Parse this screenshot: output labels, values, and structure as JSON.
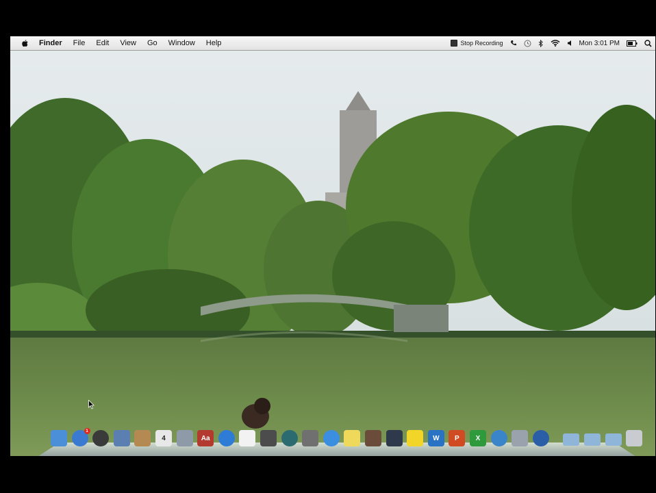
{
  "menubar": {
    "app_name": "Finder",
    "menus": [
      "File",
      "Edit",
      "View",
      "Go",
      "Window",
      "Help"
    ],
    "status": {
      "recording_label": "Stop Recording",
      "clock": "Mon 3:01 PM"
    }
  },
  "icons": {
    "apple": "apple-icon",
    "stop_recording": "stop-recording-icon",
    "phone": "phone-icon",
    "time_machine": "time-machine-icon",
    "bluetooth": "bluetooth-icon",
    "wifi": "wifi-icon",
    "volume": "volume-icon",
    "battery": "battery-icon",
    "spotlight": "spotlight-icon"
  },
  "dock": {
    "items": [
      {
        "name": "finder-icon",
        "color": "#4a8fd8"
      },
      {
        "name": "app-store-icon",
        "color": "#3a7ad0",
        "badge": "1"
      },
      {
        "name": "dashboard-icon",
        "color": "#3a3a3a"
      },
      {
        "name": "preview-icon",
        "color": "#5b7fb0"
      },
      {
        "name": "contacts-icon",
        "color": "#b58a52"
      },
      {
        "name": "calendar-icon",
        "color": "#e8e8e8",
        "text": "4"
      },
      {
        "name": "iphoto-icon",
        "color": "#8e9aa8"
      },
      {
        "name": "dictionary-icon",
        "color": "#b23a2e",
        "text": "Aa"
      },
      {
        "name": "itunes-icon",
        "color": "#2e7cd6"
      },
      {
        "name": "textedit-icon",
        "color": "#f2f2f2"
      },
      {
        "name": "photo-booth-icon",
        "color": "#4c4c4c"
      },
      {
        "name": "time-machine-app-icon",
        "color": "#2c6b70"
      },
      {
        "name": "screenshot-app-icon",
        "color": "#707070"
      },
      {
        "name": "safari-icon",
        "color": "#3b8ee0"
      },
      {
        "name": "stickies-icon",
        "color": "#efd95a"
      },
      {
        "name": "movie-app-icon",
        "color": "#6b4c3a"
      },
      {
        "name": "amazon-app-icon",
        "color": "#2e3a4c"
      },
      {
        "name": "notes-app-icon",
        "color": "#f1d629"
      },
      {
        "name": "word-icon",
        "color": "#2a72c4",
        "text": "W"
      },
      {
        "name": "powerpoint-icon",
        "color": "#d04a22",
        "text": "P"
      },
      {
        "name": "excel-icon",
        "color": "#2e9a3c",
        "text": "X"
      },
      {
        "name": "globe-app-icon",
        "color": "#3a84c9"
      },
      {
        "name": "system-prefs-icon",
        "color": "#9aa3ad"
      },
      {
        "name": "quicktime-icon",
        "color": "#2a5fa8"
      },
      {
        "name": "applications-folder-icon",
        "color": "#8fb6d8"
      },
      {
        "name": "documents-folder-icon",
        "color": "#8fb6d8"
      },
      {
        "name": "downloads-folder-icon",
        "color": "#8fb6d8"
      },
      {
        "name": "trash-icon",
        "color": "#c8ccd0"
      }
    ]
  }
}
